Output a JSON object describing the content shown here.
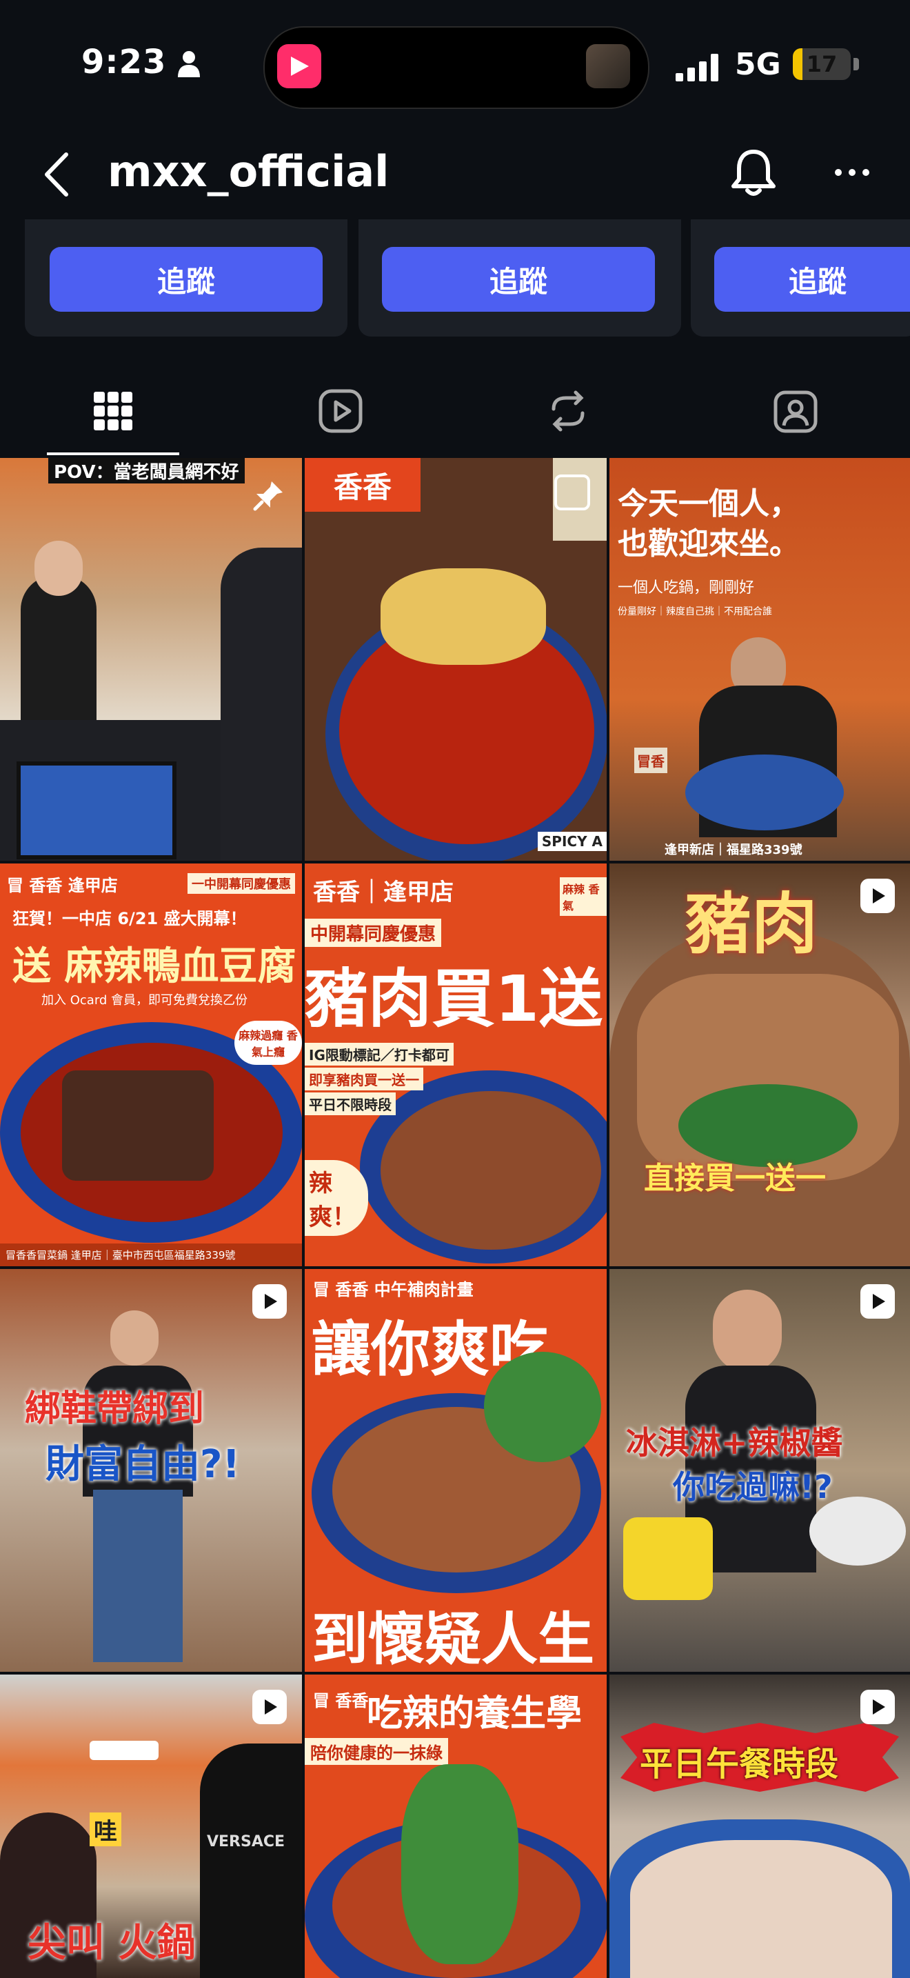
{
  "status_bar": {
    "time": "9:23",
    "network": "5G",
    "battery": "17",
    "battery_level": 0.17
  },
  "header": {
    "username": "mxx_official"
  },
  "suggestions": {
    "follow_label": "追蹤"
  },
  "posts": [
    {
      "texts": [
        "POV：當老闆員網不好"
      ],
      "pinned": true,
      "reel": false
    },
    {
      "texts": [
        "香香",
        "SPICY A"
      ],
      "pinned": false,
      "reel": false
    },
    {
      "texts": [
        "今天一個人，",
        "也歡迎來坐。",
        "一個人吃鍋，剛剛好",
        "份量剛好｜辣度自己挑｜不用配合誰",
        "冒香",
        "逢甲新店｜福星路339號"
      ],
      "pinned": false,
      "reel": false
    },
    {
      "texts": [
        "冒 香香 逢甲店",
        "一中開幕同慶優惠",
        "狂賀！一中店 6/21 盛大開幕！",
        "送 麻辣鴨血豆腐",
        "加入 Ocard 會員，即可免費兌換乙份",
        "麻辣過癮 香氣上癮",
        "冒香香冒菜鍋 逢甲店｜臺中市西屯區福星路339號"
      ],
      "pinned": false,
      "reel": false
    },
    {
      "texts": [
        "香香｜逢甲店",
        "中開幕同慶優惠",
        "豬肉買1送",
        "IG限動標記／打卡都可",
        "即享豬肉買一送一",
        "平日不限時段",
        "辣 爽！",
        "麻辣 香氣"
      ],
      "pinned": false,
      "reel": false
    },
    {
      "texts": [
        "豬肉",
        "直接買一送一"
      ],
      "pinned": false,
      "reel": true
    },
    {
      "texts": [
        "綁鞋帶綁到",
        "財富自由?!"
      ],
      "pinned": false,
      "reel": true
    },
    {
      "texts": [
        "冒 香香 中午補肉計畫",
        "讓你爽吃",
        "到懷疑人生"
      ],
      "pinned": false,
      "reel": false
    },
    {
      "texts": [
        "冰淇淋+辣椒醬",
        "你吃過嘛!?"
      ],
      "pinned": false,
      "reel": true
    },
    {
      "texts": [
        "哇",
        "尖叫 火鍋",
        "VERSACE"
      ],
      "pinned": false,
      "reel": true
    },
    {
      "texts": [
        "冒 香香",
        "吃辣的養生學",
        "陪你健康的一抹綠"
      ],
      "pinned": false,
      "reel": false
    },
    {
      "texts": [
        "平日午餐時段"
      ],
      "pinned": false,
      "reel": true
    }
  ]
}
